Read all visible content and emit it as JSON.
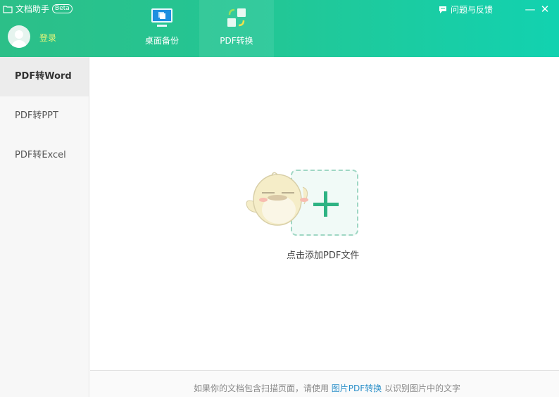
{
  "app": {
    "title": "文档助手",
    "badge": "Beta"
  },
  "user": {
    "login_label": "登录"
  },
  "nav": [
    {
      "label": "桌面备份"
    },
    {
      "label": "PDF转换"
    }
  ],
  "topbar": {
    "feedback_label": "问题与反馈",
    "minimize": "—",
    "close": "✕"
  },
  "sidebar": {
    "items": [
      {
        "label": "PDF转Word"
      },
      {
        "label": "PDF转PPT"
      },
      {
        "label": "PDF转Excel"
      }
    ]
  },
  "main": {
    "drop_label": "点击添加PDF文件"
  },
  "footer": {
    "prefix": "如果你的文档包含扫描页面，请使用 ",
    "link": "图片PDF转换",
    "suffix": " 以识别图片中的文字"
  },
  "colors": {
    "accent": "#2eb383",
    "link": "#2a8fc9"
  }
}
